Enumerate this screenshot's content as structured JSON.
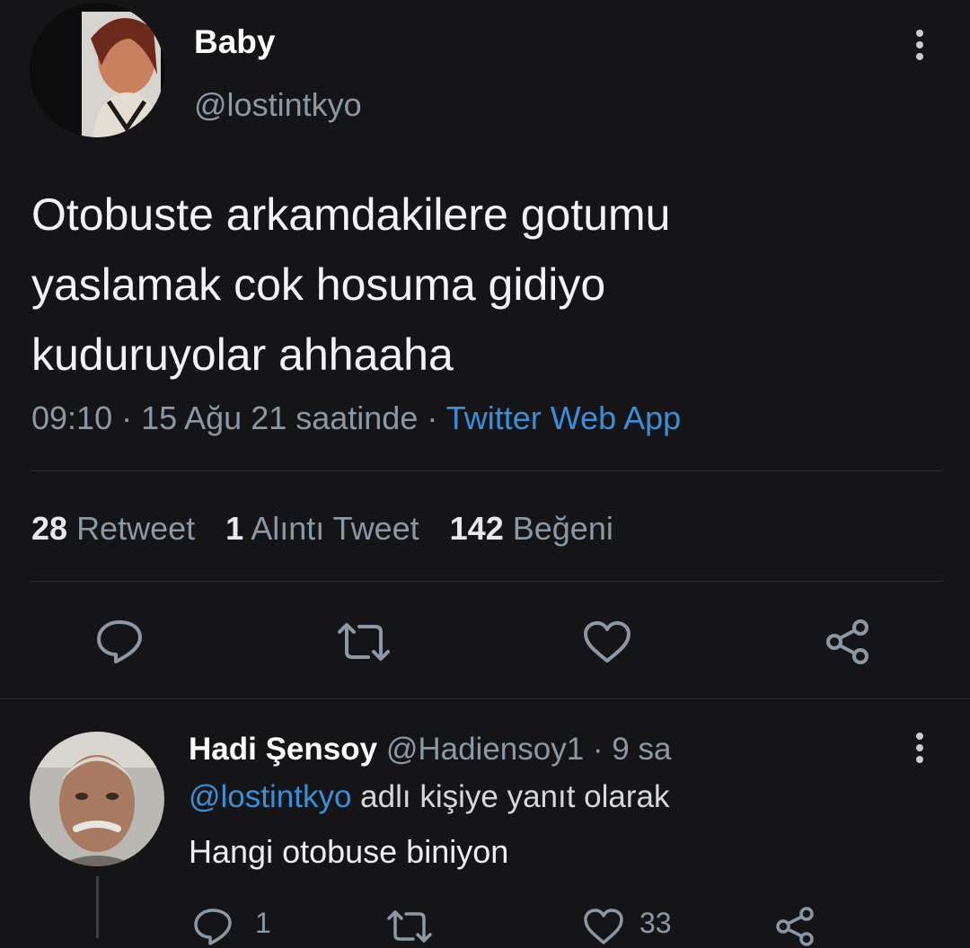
{
  "tweet": {
    "author_name": "Baby",
    "author_handle": "@lostintkyo",
    "text_lines": [
      "Otobuste arkamdakilere gotumu",
      "yaslamak cok hosuma gidiyo",
      "kuduruyolar ahhaaha"
    ],
    "time": "09:10 · 15 Ağu 21 saatinde",
    "separator": "·",
    "source": "Twitter Web App",
    "stats": {
      "retweet_count": "28",
      "retweet_label": "Retweet",
      "quote_count": "1",
      "quote_label": "Alıntı Tweet",
      "like_count": "142",
      "like_label": "Beğeni"
    }
  },
  "reply": {
    "author_name": "Hadi Şensoy",
    "author_handle": "@Hadiensoy1",
    "age": "· 9 sa",
    "reply_to_handle": "@lostintkyo",
    "reply_to_suffix": "adlı kişiye yanıt olarak",
    "text": "Hangi otobuse biniyon",
    "reply_count": "1",
    "like_count": "33"
  },
  "icons": {
    "more": "more-vertical-icon",
    "reply": "reply-icon",
    "retweet": "retweet-icon",
    "like": "heart-icon",
    "share": "share-icon"
  },
  "colors": {
    "background": "#151518",
    "link": "#3b8fd9",
    "muted": "#8b98a5"
  }
}
